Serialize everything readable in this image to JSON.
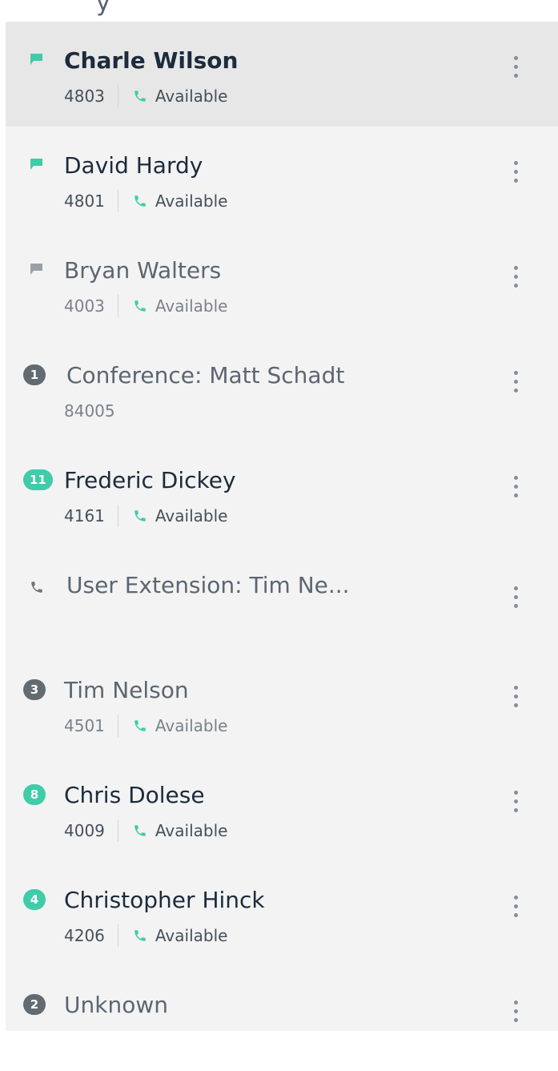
{
  "top_fragment": "y",
  "accent_color": "#3fcca9",
  "contacts": [
    {
      "name": "Charle Wilson",
      "extension": "4803",
      "status": "Available",
      "indicator_icon": "message-flag-icon",
      "indicator_color": "#3fcca9",
      "selected": true
    },
    {
      "name": "David Hardy",
      "extension": "4801",
      "status": "Available",
      "indicator_icon": "message-flag-icon",
      "indicator_color": "#3fcca9"
    },
    {
      "name": "Bryan Walters",
      "extension": "4003",
      "status": "Available",
      "indicator_icon": "message-flag-icon",
      "indicator_color": "#9aa0a6"
    },
    {
      "name": "Conference: Matt Schadt",
      "extension": "84005",
      "badge": "1",
      "badge_color": "#626a72"
    },
    {
      "name": "Frederic Dickey",
      "extension": "4161",
      "status": "Available",
      "badge": "11",
      "badge_color": "#3fcca9"
    },
    {
      "name": "User Extension: Tim Ne...",
      "indicator_icon": "phone-icon",
      "indicator_color": "#6d747c"
    },
    {
      "name": "Tim Nelson",
      "extension": "4501",
      "status": "Available",
      "badge": "3",
      "badge_color": "#626a72"
    },
    {
      "name": "Chris Dolese",
      "extension": "4009",
      "status": "Available",
      "badge": "8",
      "badge_color": "#3fcca9"
    },
    {
      "name": "Christopher Hinck",
      "extension": "4206",
      "status": "Available",
      "badge": "4",
      "badge_color": "#3fcca9"
    },
    {
      "name": "Unknown",
      "badge": "2",
      "badge_color": "#626a72"
    }
  ]
}
